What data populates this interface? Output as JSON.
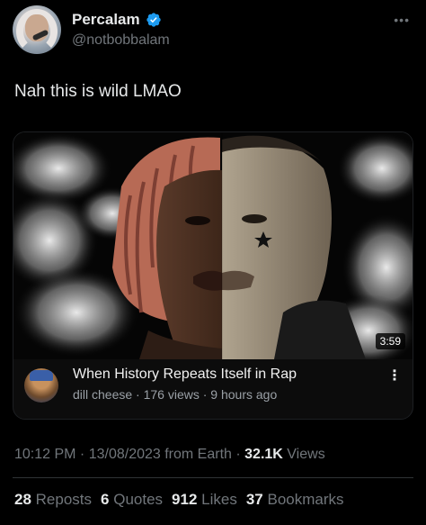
{
  "author": {
    "display_name": "Percalam",
    "handle": "@notbobbalam",
    "verified": true
  },
  "menu_icon": "more-horizontal-icon",
  "tweet": {
    "text": "Nah this is wild LMAO"
  },
  "video_card": {
    "duration": "3:59",
    "title": "When History Repeats Itself in Rap",
    "meta": "dill cheese · 176 views · 9 hours ago",
    "menu_icon": "more-vertical-icon"
  },
  "post_meta": {
    "time": "10:12 PM",
    "date": "13/08/2023",
    "source": "from Earth",
    "views_count": "32.1K",
    "views_label": "Views"
  },
  "stats": {
    "reposts_count": "28",
    "reposts_label": "Reposts",
    "quotes_count": "6",
    "quotes_label": "Quotes",
    "likes_count": "912",
    "likes_label": "Likes",
    "bookmarks_count": "37",
    "bookmarks_label": "Bookmarks"
  },
  "colors": {
    "background": "#000000",
    "text_primary": "#e7e9ea",
    "text_secondary": "#71767b",
    "verified_blue": "#1d9bf0"
  }
}
